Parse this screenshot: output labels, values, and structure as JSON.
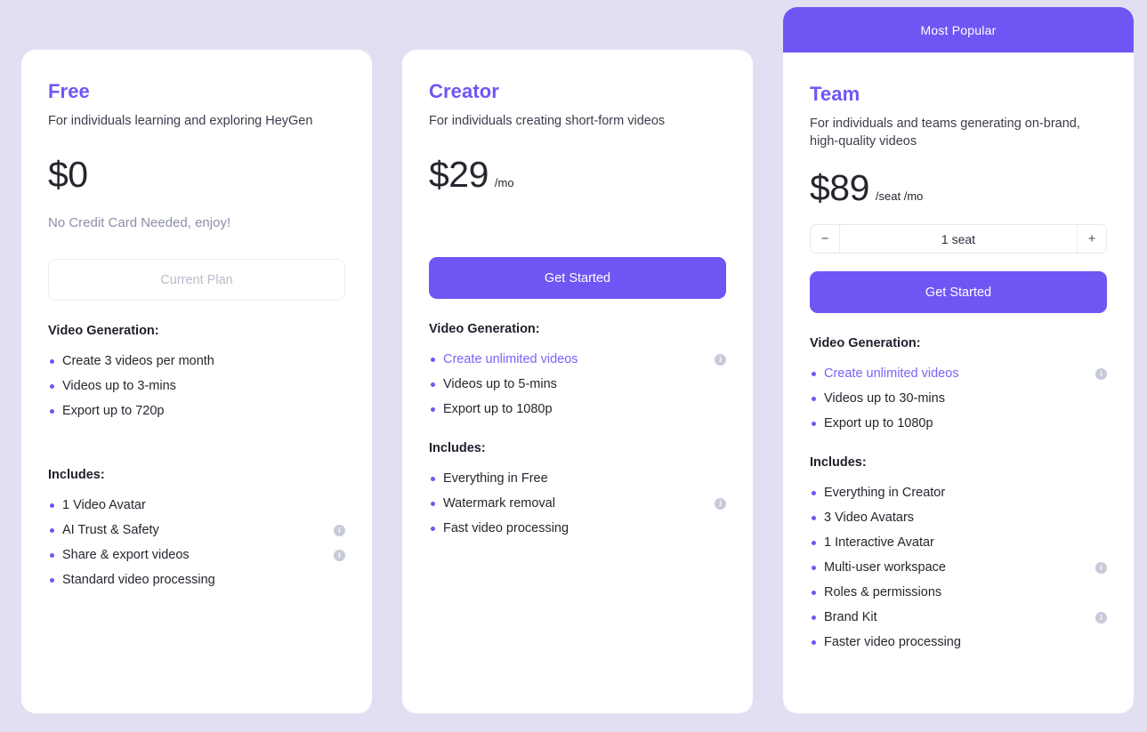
{
  "page": {
    "background_color": "#e3dff2",
    "accent_color": "#6f56f4"
  },
  "plans": [
    {
      "id": "free",
      "name": "Free",
      "tagline": "For individuals learning and exploring HeyGen",
      "price_amount": "$0",
      "price_unit": "",
      "price_note": "No Credit Card Needed, enjoy!",
      "cta_label": "Current Plan",
      "cta_type": "current",
      "sections": [
        {
          "heading": "Video Generation:",
          "items": [
            {
              "text": "Create 3 videos per month",
              "highlight": false,
              "info": false
            },
            {
              "text": "Videos up to 3-mins",
              "highlight": false,
              "info": false
            },
            {
              "text": "Export up to 720p",
              "highlight": false,
              "info": false
            }
          ]
        },
        {
          "heading": "Includes:",
          "extra_gap": true,
          "items": [
            {
              "text": "1 Video Avatar",
              "highlight": false,
              "info": false
            },
            {
              "text": "AI Trust & Safety",
              "highlight": false,
              "info": true
            },
            {
              "text": "Share & export videos",
              "highlight": false,
              "info": true
            },
            {
              "text": "Standard video processing",
              "highlight": false,
              "info": false
            }
          ]
        }
      ]
    },
    {
      "id": "creator",
      "name": "Creator",
      "tagline": "For individuals creating short-form videos",
      "price_amount": "$29",
      "price_unit": "/mo",
      "price_note": "",
      "cta_label": "Get Started",
      "cta_type": "primary",
      "sections": [
        {
          "heading": "Video Generation:",
          "items": [
            {
              "text": "Create unlimited videos",
              "highlight": true,
              "info": true
            },
            {
              "text": "Videos up to 5-mins",
              "highlight": false,
              "info": false
            },
            {
              "text": "Export up to 1080p",
              "highlight": false,
              "info": false
            }
          ]
        },
        {
          "heading": "Includes:",
          "extra_gap": false,
          "items": [
            {
              "text": "Everything in Free",
              "highlight": false,
              "info": false
            },
            {
              "text": "Watermark removal",
              "highlight": false,
              "info": true
            },
            {
              "text": "Fast video processing",
              "highlight": false,
              "info": false
            }
          ]
        }
      ]
    },
    {
      "id": "team",
      "name": "Team",
      "badge": "Most Popular",
      "tagline": "For individuals and teams generating on-brand, high-quality videos",
      "price_amount": "$89",
      "price_unit": "/seat /mo",
      "price_note": "",
      "seat_stepper": {
        "decrement_label": "−",
        "increment_label": "+",
        "value_label": "1 seat"
      },
      "cta_label": "Get Started",
      "cta_type": "primary",
      "sections": [
        {
          "heading": "Video Generation:",
          "items": [
            {
              "text": "Create unlimited videos",
              "highlight": true,
              "info": true
            },
            {
              "text": "Videos up to 30-mins",
              "highlight": false,
              "info": false
            },
            {
              "text": "Export up to 1080p",
              "highlight": false,
              "info": false
            }
          ]
        },
        {
          "heading": "Includes:",
          "extra_gap": false,
          "items": [
            {
              "text": "Everything in Creator",
              "highlight": false,
              "info": false
            },
            {
              "text": "3 Video Avatars",
              "highlight": false,
              "info": false
            },
            {
              "text": "1 Interactive Avatar",
              "highlight": false,
              "info": false
            },
            {
              "text": "Multi-user workspace",
              "highlight": false,
              "info": true
            },
            {
              "text": "Roles & permissions",
              "highlight": false,
              "info": false
            },
            {
              "text": "Brand Kit",
              "highlight": false,
              "info": true
            },
            {
              "text": "Faster video processing",
              "highlight": false,
              "info": false
            }
          ]
        }
      ]
    }
  ]
}
